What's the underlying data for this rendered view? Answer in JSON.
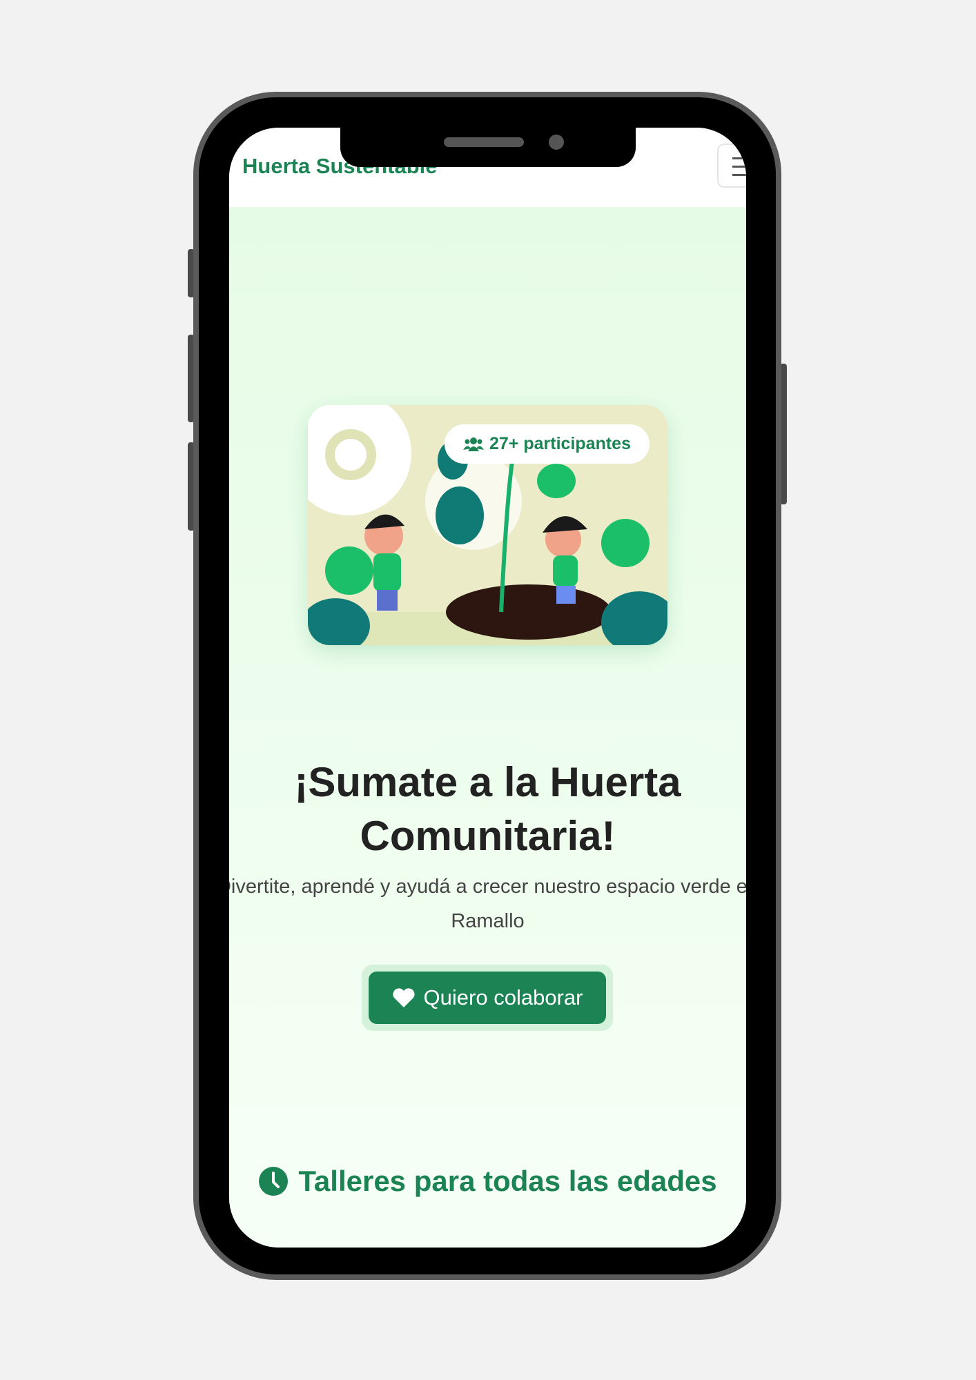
{
  "header": {
    "brand": "Huerta Sustentable",
    "menu_icon": "hamburger-icon"
  },
  "hero": {
    "badge": "27+ participantes",
    "title": "¡Sumate a la Huerta Comunitaria!",
    "subtitle": "Divertite, aprendé y ayudá a crecer nuestro espacio verde en Ramallo",
    "cta": "Quiero colaborar"
  },
  "section": {
    "title": "Talleres para todas las edades"
  },
  "colors": {
    "primary": "#1b8354",
    "hero_bg": "#e6fbe6"
  }
}
